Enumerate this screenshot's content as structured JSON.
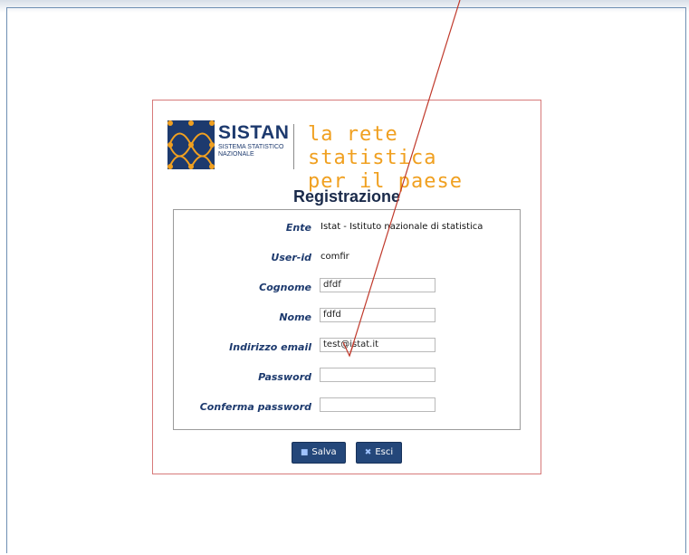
{
  "brand": {
    "name": "SISTAN",
    "subtitle_line1": "Sistema Statistico",
    "subtitle_line2": "Nazionale",
    "tagline_line1": "la rete statistica",
    "tagline_line2": "per il paese"
  },
  "page_title": "Registrazione",
  "form": {
    "ente_label": "Ente",
    "ente_value": "Istat - Istituto nazionale di statistica",
    "userid_label": "User-id",
    "userid_value": "comfir",
    "cognome_label": "Cognome",
    "cognome_value": "dfdf",
    "nome_label": "Nome",
    "nome_value": "fdfd",
    "email_label": "Indirizzo email",
    "email_value": "test@istat.it",
    "password_label": "Password",
    "password_value": "",
    "conferma_label": "Conferma password",
    "conferma_value": ""
  },
  "buttons": {
    "save_label": "Salva",
    "exit_label": "Esci",
    "save_icon": "floppy-icon",
    "exit_icon": "close-icon"
  },
  "colors": {
    "brand_blue": "#1d3a6e",
    "tagline_orange": "#f0a020",
    "button_blue": "#24477a",
    "card_border": "#d77a7a",
    "annotation_arrow": "#c0392b"
  }
}
